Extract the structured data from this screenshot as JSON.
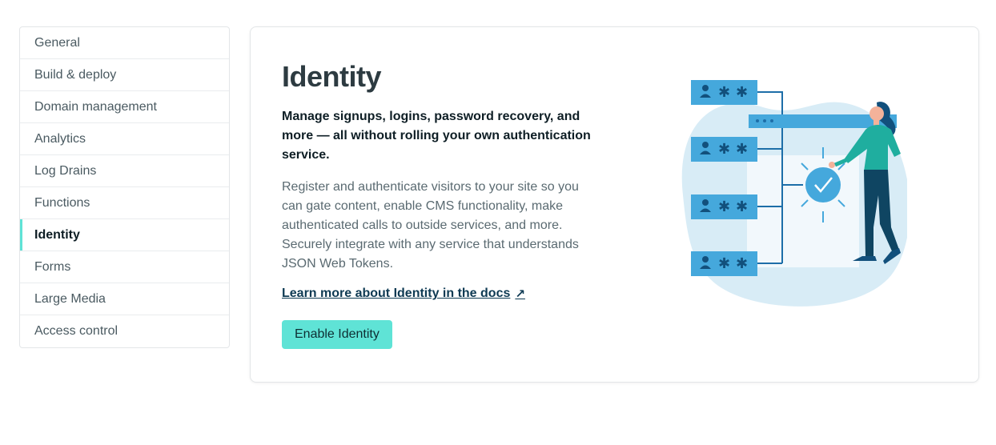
{
  "sidebar": {
    "items": [
      {
        "label": "General",
        "active": false
      },
      {
        "label": "Build & deploy",
        "active": false
      },
      {
        "label": "Domain management",
        "active": false
      },
      {
        "label": "Analytics",
        "active": false
      },
      {
        "label": "Log Drains",
        "active": false
      },
      {
        "label": "Functions",
        "active": false
      },
      {
        "label": "Identity",
        "active": true
      },
      {
        "label": "Forms",
        "active": false
      },
      {
        "label": "Large Media",
        "active": false
      },
      {
        "label": "Access control",
        "active": false
      }
    ]
  },
  "main": {
    "title": "Identity",
    "lead": "Manage signups, logins, password recovery, and more — all without rolling your own authentication service.",
    "body": "Register and authenticate visitors to your site so you can gate content, enable CMS functionality, make authenticated calls to outside services, and more. Securely integrate with any service that understands JSON Web Tokens.",
    "docs_link": "Learn more about Identity in the docs",
    "docs_link_icon": "arrow-up-right-icon",
    "enable_button": "Enable Identity"
  },
  "colors": {
    "accent": "#5fe3d6",
    "illustration_blue": "#45a8dc",
    "illustration_bg": "#d8ecf6"
  }
}
